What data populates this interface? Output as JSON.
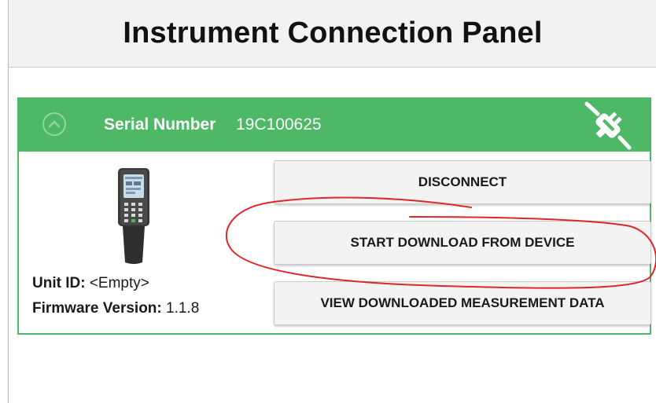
{
  "panel": {
    "title": "Instrument Connection Panel"
  },
  "instrument": {
    "serial_label": "Serial Number",
    "serial_number": "19C100625",
    "unit_id_label": "Unit ID:",
    "unit_id_value": "<Empty>",
    "firmware_label": "Firmware Version:",
    "firmware_value": "1.1.8"
  },
  "actions": {
    "disconnect_label": "DISCONNECT",
    "start_download_label": "START DOWNLOAD FROM DEVICE",
    "view_data_label": "VIEW DOWNLOADED MEASUREMENT DATA"
  },
  "icons": {
    "collapse": "chevron-up-circle-icon",
    "disconnect_status": "unplugged-icon",
    "device": "handheld-meter-icon"
  },
  "colors": {
    "header_green": "#4db966",
    "annotation_red": "#e0262a"
  }
}
